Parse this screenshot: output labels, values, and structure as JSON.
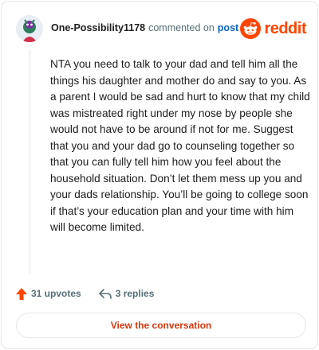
{
  "comment": {
    "author": "One-Possibility1178",
    "action": "commented on",
    "post_link": "post",
    "body": "NTA you need to talk to your dad and tell him all the things his daughter and mother do and say to you. As a parent I would be sad and hurt to know that my child was mistreated right under my nose by people she would not have to be around if not for me. Suggest that you and your dad go to counseling together so that you can fully tell him how you feel about the household situation. Don’t let them mess up you and your dads relationship. You’ll be going to college soon if that’s your education plan and your time with him will become limited.",
    "upvotes": "31 upvotes",
    "replies": "3 replies"
  },
  "brand": {
    "wordmark": "reddit",
    "color": "#ff4500"
  },
  "cta": {
    "label": "View the conversation"
  },
  "icons": {
    "upvote": "upvote-arrow-icon",
    "reply": "reply-arrow-icon",
    "logo": "reddit-snoo-icon"
  }
}
